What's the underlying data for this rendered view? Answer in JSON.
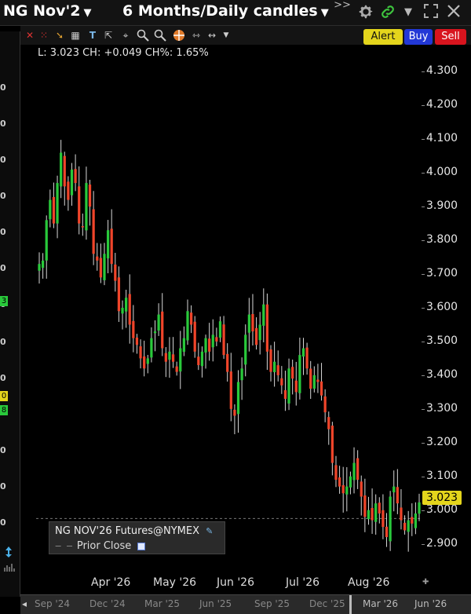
{
  "titlebar": {
    "symbol": "NG Nov'2",
    "timeframe": "6 Months/Daily candles",
    "more_glyph": ">>"
  },
  "buttons": {
    "alert": "Alert",
    "buy": "Buy",
    "sell": "Sell"
  },
  "info_line": "L: 3.023 CH: +0.049 CH%: 1.65%",
  "legend": {
    "title": "NG NOV'26 Futures@NYMEX",
    "prior_close": "Prior Close"
  },
  "left_strip": {
    "numbers": [
      "0",
      "0",
      "0",
      "0",
      "0",
      "0",
      "0",
      "0",
      "0",
      "0",
      "0",
      "0",
      "0",
      "0",
      "0",
      "0"
    ],
    "badges": [
      "3",
      "0",
      "8"
    ]
  },
  "colors": {
    "up": "#29c93b",
    "down": "#f0452a",
    "price_badge": "#e4d51c",
    "alert": "#e4d51c",
    "buy": "#2238d6",
    "sell": "#d8141e"
  },
  "chart_data": {
    "type": "candlestick",
    "ylim": [
      2.82,
      4.38
    ],
    "y_ticks": [
      "4.300",
      "4.200",
      "4.100",
      "4.000",
      "3.900",
      "3.800",
      "3.700",
      "3.600",
      "3.500",
      "3.400",
      "3.300",
      "3.200",
      "3.100",
      "3.000",
      "2.900"
    ],
    "x_labels": [
      "Apr '26",
      "May '26",
      "Jun '26",
      "Jul '26",
      "Aug '26"
    ],
    "last_price": "3.023",
    "prior_close": 2.975,
    "closes": [
      3.73,
      3.74,
      3.86,
      3.92,
      3.85,
      3.97,
      4.06,
      3.96,
      3.92,
      4.01,
      3.97,
      3.85,
      3.84,
      3.97,
      3.9,
      3.76,
      3.74,
      3.69,
      3.76,
      3.83,
      3.73,
      3.68,
      3.59,
      3.6,
      3.63,
      3.55,
      3.51,
      3.49,
      3.45,
      3.42,
      3.45,
      3.51,
      3.53,
      3.58,
      3.48,
      3.44,
      3.47,
      3.44,
      3.41,
      3.48,
      3.51,
      3.59,
      3.55,
      3.47,
      3.43,
      3.47,
      3.51,
      3.47,
      3.52,
      3.5,
      3.56,
      3.46,
      3.41,
      3.3,
      3.28,
      3.38,
      3.42,
      3.52,
      3.58,
      3.53,
      3.49,
      3.55,
      3.61,
      3.47,
      3.41,
      3.44,
      3.4,
      3.37,
      3.33,
      3.42,
      3.39,
      3.35,
      3.46,
      3.48,
      3.42,
      3.36,
      3.4,
      3.38,
      3.34,
      3.29,
      3.24,
      3.14,
      3.09,
      3.07,
      3.05,
      3.07,
      3.1,
      3.14,
      3.09,
      3.04,
      2.98,
      3.0,
      2.97,
      3.02,
      2.99,
      2.95,
      2.92,
      3.04,
      3.07,
      3.02,
      2.97,
      2.94,
      2.97,
      2.96,
      2.99,
      3.023
    ]
  }
}
